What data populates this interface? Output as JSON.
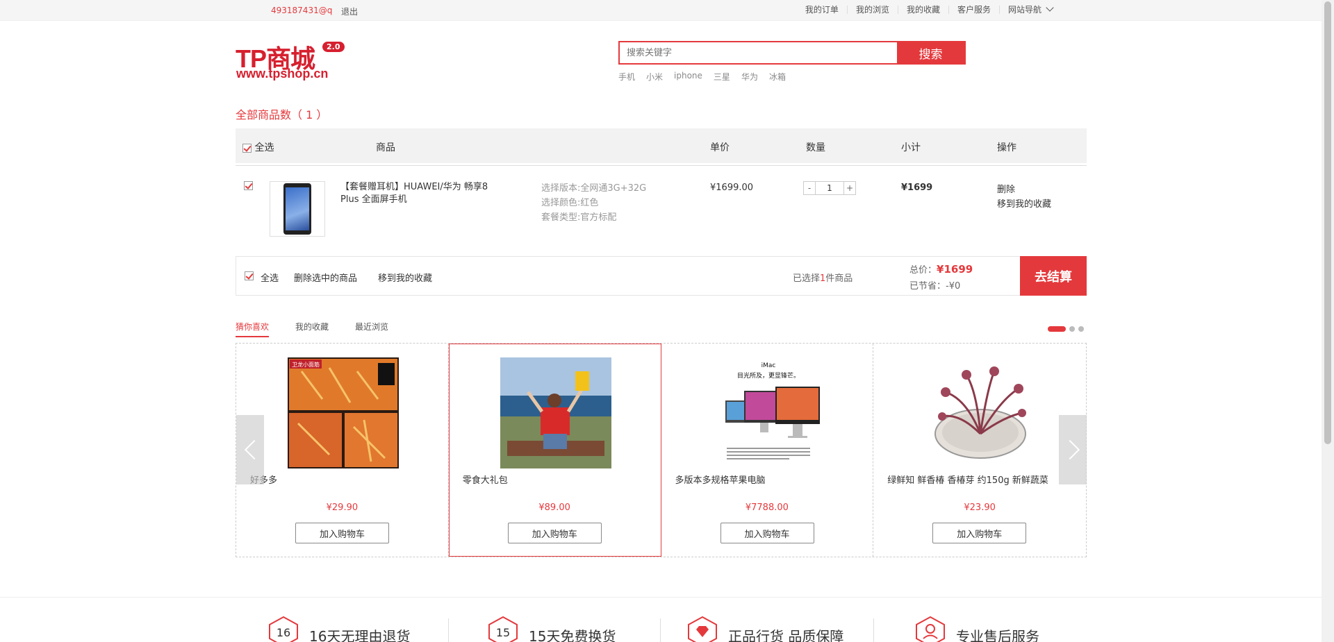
{
  "topbar": {
    "user": "493187431@q",
    "logout": "退出",
    "links": [
      "我的订单",
      "我的浏览",
      "我的收藏",
      "客户服务",
      "网站导航"
    ]
  },
  "logo": {
    "main": "TP商城",
    "version": "2.0",
    "domain": "www.tpshop.cn"
  },
  "search": {
    "placeholder": "搜索关键字",
    "button": "搜索",
    "hot": [
      "手机",
      "小米",
      "iphone",
      "三星",
      "华为",
      "冰箱"
    ]
  },
  "cart": {
    "tab": "全部商品数（ 1 ）",
    "header": {
      "select_all": "全选",
      "product": "商品",
      "unit_price": "单价",
      "quantity": "数量",
      "subtotal": "小计",
      "actions": "操作"
    },
    "item": {
      "name": "【套餐赠耳机】HUAWEI/华为 畅享8 Plus 全面屏手机",
      "spec_version": "选择版本:全网通3G+32G",
      "spec_color": "选择颜色:红色",
      "spec_package": "套餐类型:官方标配",
      "price": "¥1699.00",
      "qty": "1",
      "minus": "-",
      "plus": "+",
      "subtotal": "¥1699",
      "delete": "删除",
      "move": "移到我的收藏"
    },
    "footer": {
      "select_all": "全选",
      "delete_selected": "删除选中的商品",
      "move_fav": "移到我的收藏",
      "selected_prefix": "已选择",
      "selected_count": "1",
      "selected_suffix": "件商品",
      "total_label": "总价：",
      "total": "¥1699",
      "saved": "已节省：-¥0",
      "checkout": "去结算"
    }
  },
  "recommend": {
    "tabs": [
      "猜你喜欢",
      "我的收藏",
      "最近浏览"
    ],
    "products": [
      {
        "name": "好多多",
        "price": "¥29.90",
        "button": "加入购物车"
      },
      {
        "name": "零食大礼包",
        "price": "¥89.00",
        "button": "加入购物车"
      },
      {
        "name": "多版本多规格苹果电脑",
        "price": "¥7788.00",
        "button": "加入购物车"
      },
      {
        "name": "绿鲜知 鲜香椿 香椿芽 约150g 新鲜蔬菜",
        "price": "¥23.90",
        "button": "加入购物车"
      }
    ],
    "img_text": {
      "snack_top": "卫龙小面筋",
      "imac_brand": "iMac",
      "imac_slogan": "目光所及，更显锋芒。"
    }
  },
  "service": [
    {
      "icon_text": "16",
      "label": "16天无理由退货"
    },
    {
      "icon_text": "15",
      "label": "15天免费换货"
    },
    {
      "icon_text": "",
      "label": "正品行货 品质保障"
    },
    {
      "icon_text": "",
      "label": "专业售后服务"
    }
  ],
  "colors": {
    "accent": "#e4393c"
  }
}
